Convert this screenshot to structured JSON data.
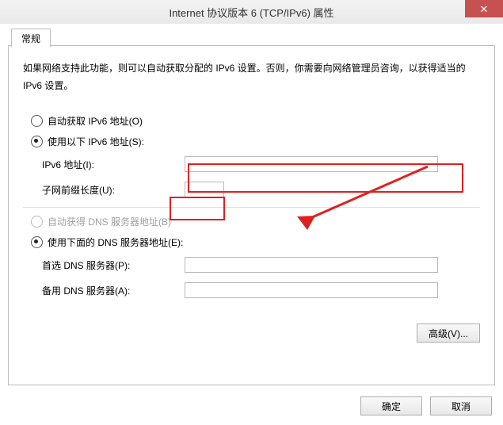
{
  "window": {
    "title": "Internet 协议版本 6 (TCP/IPv6) 属性",
    "close_symbol": "✕"
  },
  "tab": {
    "label": "常规"
  },
  "description": "如果网络支持此功能，则可以自动获取分配的 IPv6 设置。否则，你需要向网络管理员咨询，以获得适当的 IPv6 设置。",
  "addr_group": {
    "auto_label": "自动获取 IPv6 地址(O)",
    "manual_label": "使用以下 IPv6 地址(S):",
    "ip_label": "IPv6 地址(I):",
    "ip_value": "",
    "prefix_label": "子网前缀长度(U):",
    "prefix_value": ""
  },
  "dns_group": {
    "auto_label": "自动获得 DNS 服务器地址(B)",
    "manual_label": "使用下面的 DNS 服务器地址(E):",
    "pref_label": "首选 DNS 服务器(P):",
    "pref_value": "",
    "alt_label": "备用 DNS 服务器(A):",
    "alt_value": ""
  },
  "buttons": {
    "advanced": "高级(V)...",
    "ok": "确定",
    "cancel": "取消"
  }
}
